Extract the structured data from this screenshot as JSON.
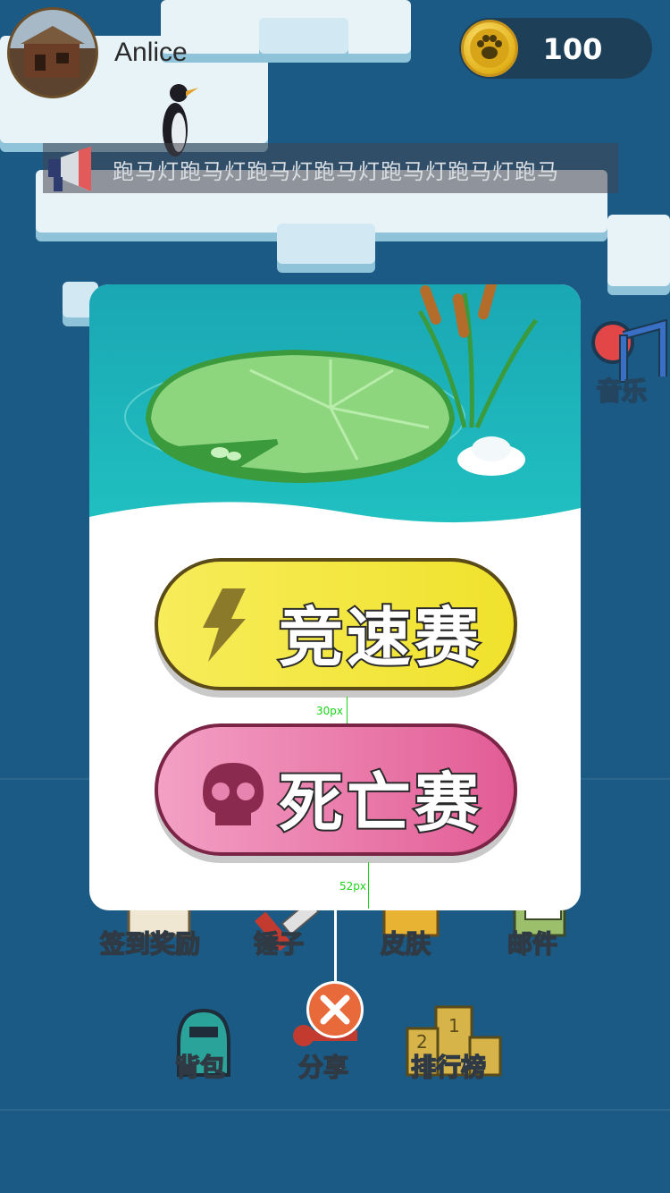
{
  "player": {
    "name": "Anlice"
  },
  "coins": {
    "count": "100"
  },
  "marquee": {
    "text": "跑马灯跑马灯跑马灯跑马灯跑马灯跑马灯跑马"
  },
  "music": {
    "label": "音乐"
  },
  "modal": {
    "speed_label": "竞速赛",
    "death_label": "死亡赛",
    "gap1": "30px",
    "gap2": "52px"
  },
  "menu_row1": [
    {
      "label": "签到奖励"
    },
    {
      "label": "锤子"
    },
    {
      "label": "皮肤"
    },
    {
      "label": "邮件"
    }
  ],
  "menu_row2": [
    {
      "label": "背包"
    },
    {
      "label": "分享"
    },
    {
      "label": "排行榜"
    }
  ],
  "colors": {
    "speed_button": "#f0e22c",
    "death_button": "#e25c95",
    "close_button": "#e86a3b",
    "water": "#1a5a85"
  }
}
